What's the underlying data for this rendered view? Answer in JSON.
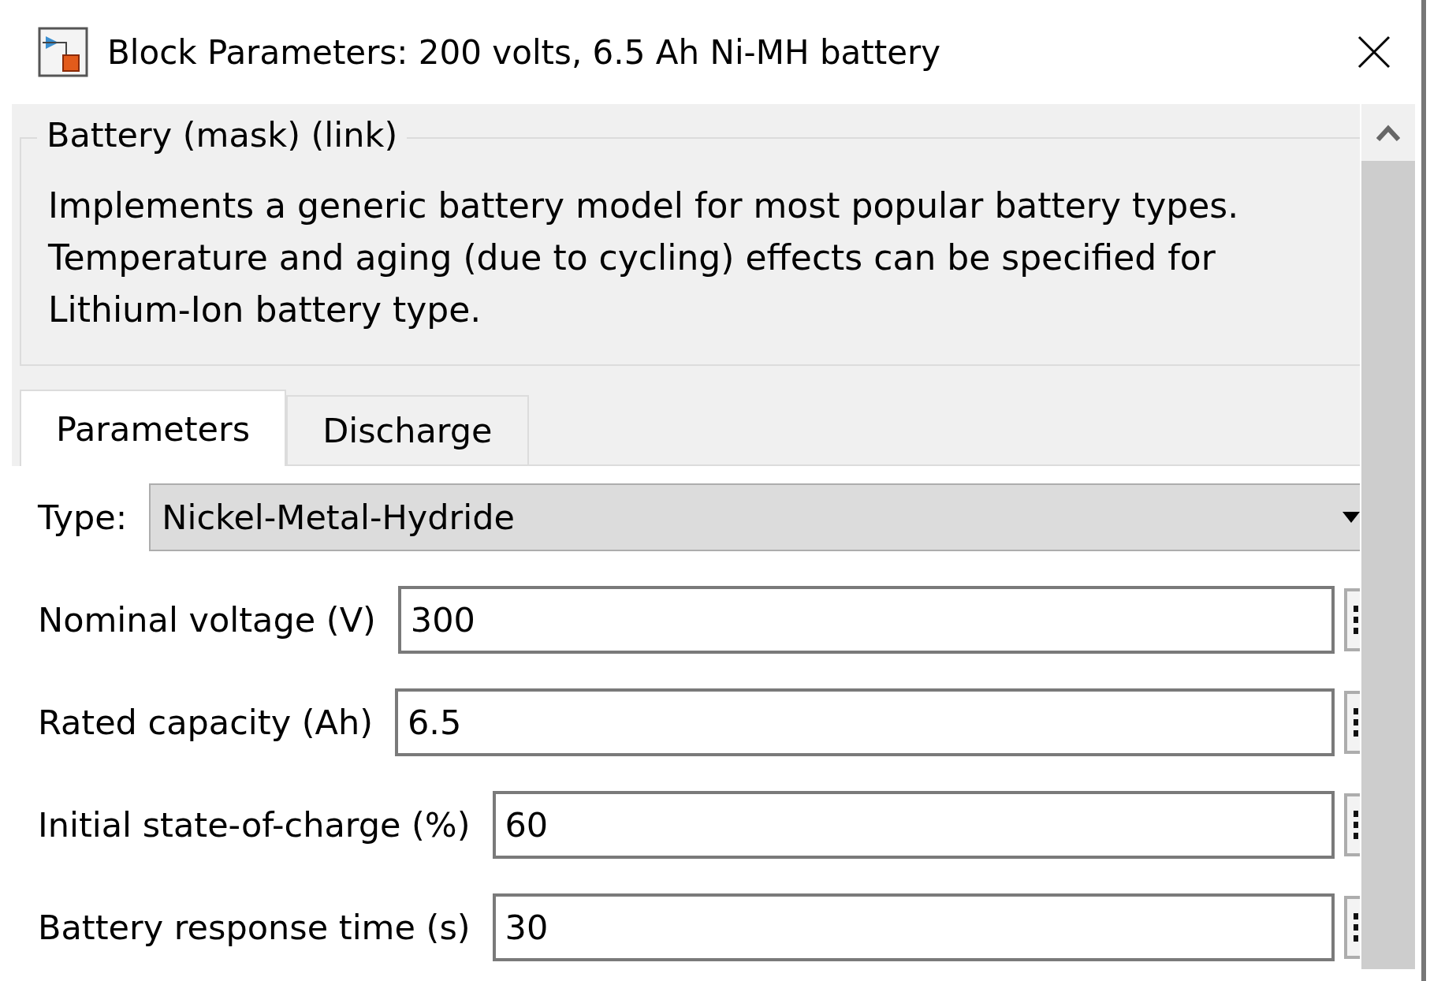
{
  "window": {
    "title": "Block Parameters: 200 volts, 6.5 Ah Ni-MH battery"
  },
  "group": {
    "legend": "Battery (mask) (link)",
    "description_lines": [
      "Implements a generic battery model for most popular battery types.",
      "Temperature and aging (due to cycling) effects can be specified for",
      "Lithium-Ion battery type."
    ]
  },
  "tabs": [
    {
      "label": "Parameters",
      "selected": true
    },
    {
      "label": "Discharge",
      "selected": false
    }
  ],
  "type_field": {
    "label": "Type:",
    "value": "Nickel-Metal-Hydride"
  },
  "parameters": [
    {
      "label": "Nominal voltage (V)",
      "value": "300"
    },
    {
      "label": "Rated capacity (Ah)",
      "value": "6.5"
    },
    {
      "label": "Initial state-of-charge (%)",
      "value": "60"
    },
    {
      "label": "Battery response time (s)",
      "value": "30"
    }
  ]
}
